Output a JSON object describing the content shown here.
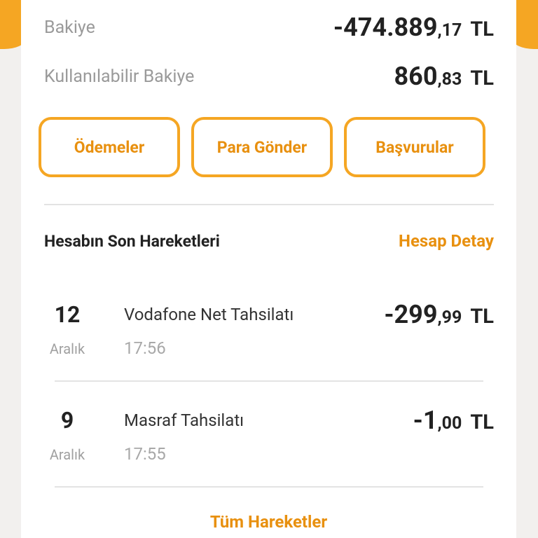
{
  "colors": {
    "accent": "#f5a623",
    "accent_text": "#e8900f",
    "background": "#f2f0ee",
    "card": "#ffffff"
  },
  "balance": {
    "label": "Bakiye",
    "amount_int": "-474.889",
    "amount_dec": ",17",
    "currency": "TL"
  },
  "available_balance": {
    "label": "Kullanılabilir Bakiye",
    "amount_int": "860",
    "amount_dec": ",83",
    "currency": "TL"
  },
  "actions": [
    {
      "label": "Ödemeler"
    },
    {
      "label": "Para Gönder"
    },
    {
      "label": "Başvurular"
    }
  ],
  "transactions_section": {
    "title": "Hesabın Son Hareketleri",
    "detail_link": "Hesap Detay",
    "all_link": "Tüm Hareketler"
  },
  "transactions": [
    {
      "day": "12",
      "month": "Aralık",
      "description": "Vodafone Net Tahsilatı",
      "time": "17:56",
      "amount_int": "-299",
      "amount_dec": ",99",
      "currency": "TL"
    },
    {
      "day": "9",
      "month": "Aralık",
      "description": "Masraf Tahsilatı",
      "time": "17:55",
      "amount_int": "-1",
      "amount_dec": ",00",
      "currency": "TL"
    }
  ]
}
